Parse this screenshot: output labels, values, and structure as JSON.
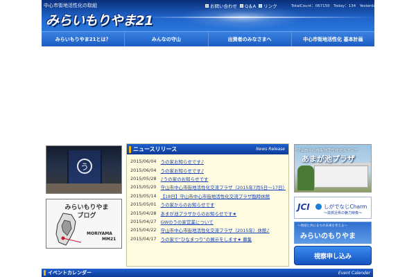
{
  "header": {
    "tagline": "中心市街地活性化の取組",
    "logo_text": "みらいもりやま21",
    "links": [
      {
        "label": "お問い合わせ",
        "icon": "square-bullet-icon"
      },
      {
        "label": "Q＆A",
        "icon": "square-bullet-icon"
      },
      {
        "label": "リンク",
        "icon": "square-bullet-icon"
      }
    ],
    "counter": "TotalCount：067150　Today：134　Yesterday：284"
  },
  "nav": {
    "items": [
      "みらいもりやま21とは？",
      "みんなの守山",
      "出資者のみなさまへ",
      "中心市街地活性化 基本計画"
    ]
  },
  "left": {
    "photo_mark": "う",
    "blog": {
      "title_line1": "みらいもりやま",
      "title_line2": "ブログ",
      "mark1": "MORIYAMA",
      "mark2": "MM21"
    }
  },
  "news": {
    "title": "ニュースリリース",
    "subtitle": "News Release",
    "items": [
      {
        "date": "2015/06/04",
        "text": "うの家お知らせです♪"
      },
      {
        "date": "2015/06/04",
        "text": "うの家お知らせです♪"
      },
      {
        "date": "2015/05/28",
        "text": "♪うの家のお知らせです"
      },
      {
        "date": "2015/05/20",
        "text": "守山市中心市街地活性化交流プラザ（2015年7月5日〜17日）休館"
      },
      {
        "date": "2015/05/14",
        "text": "【18日】守山市中心市街地活性化交流プラザ臨時休館"
      },
      {
        "date": "2015/05/01",
        "text": "うの家からのお知らせです"
      },
      {
        "date": "2015/04/28",
        "text": "あまが池プラザからのお知らせです★"
      },
      {
        "date": "2015/04/27",
        "text": "GWのうの家営業について"
      },
      {
        "date": "2015/04/22",
        "text": "守山市中心市街地活性化交流プラザ（2015年）休館♪"
      },
      {
        "date": "2015/04/17",
        "text": "うの家で“ひなまつり”の展示をします★ 募集"
      }
    ]
  },
  "right": {
    "plaza_caption_small": "守山市中心市街地活性化交流プラザ",
    "plaza_caption": "あまが池プラザ",
    "jci": {
      "logo": "JCI",
      "text": "しがでなじCharm",
      "sub": "〜滋賀近県の魅力映像〜"
    },
    "mirai": {
      "sub": "〜地域と共にまちの未来を考える〜",
      "title": "みらいのもりやま"
    },
    "apply_label": "視察申し込み"
  },
  "events": {
    "title": "イベントカレンダー",
    "subtitle": "Event Calender"
  }
}
